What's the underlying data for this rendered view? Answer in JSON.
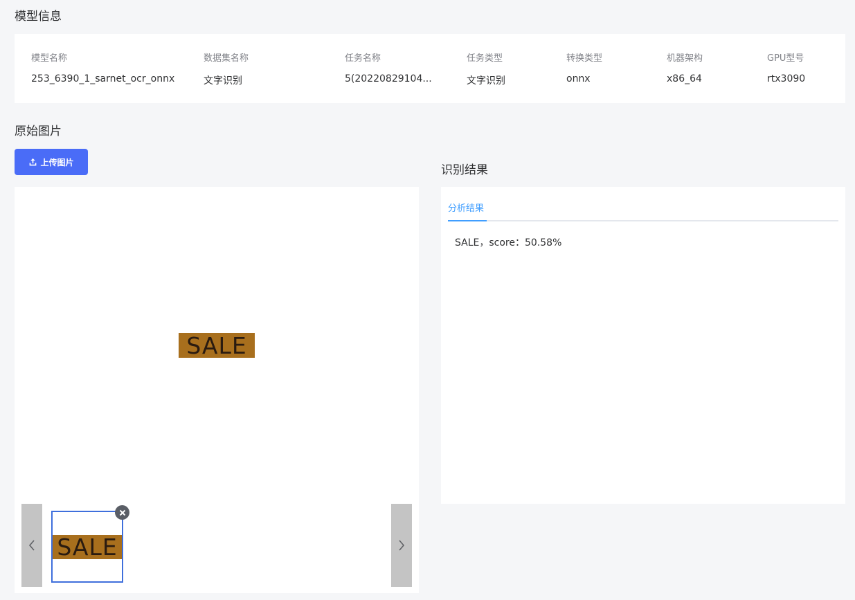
{
  "model_info": {
    "title": "模型信息",
    "fields": [
      {
        "label": "模型名称",
        "value": "253_6390_1_sarnet_ocr_onnx"
      },
      {
        "label": "数据集名称",
        "value": "文字识别"
      },
      {
        "label": "任务名称",
        "value": "5(20220829104..."
      },
      {
        "label": "任务类型",
        "value": "文字识别"
      },
      {
        "label": "转换类型",
        "value": "onnx"
      },
      {
        "label": "机器架构",
        "value": "x86_64"
      },
      {
        "label": "GPU型号",
        "value": "rtx3090"
      }
    ]
  },
  "original_image": {
    "title": "原始图片",
    "upload_label": "上传图片",
    "image_text": "SALE",
    "thumbnail_text": "SALE"
  },
  "result": {
    "title": "识别结果",
    "tab_label": "分析结果",
    "text": "SALE，score：50.58%"
  },
  "icons": {
    "upload": "upload-icon",
    "prev": "chevron-left-icon",
    "next": "chevron-right-icon",
    "close": "close-icon"
  },
  "colors": {
    "primary_button": "#4a6cf7",
    "tab_active": "#409eff",
    "thumbnail_border": "#3f6fdc",
    "image_bg": "#a86f1d"
  }
}
